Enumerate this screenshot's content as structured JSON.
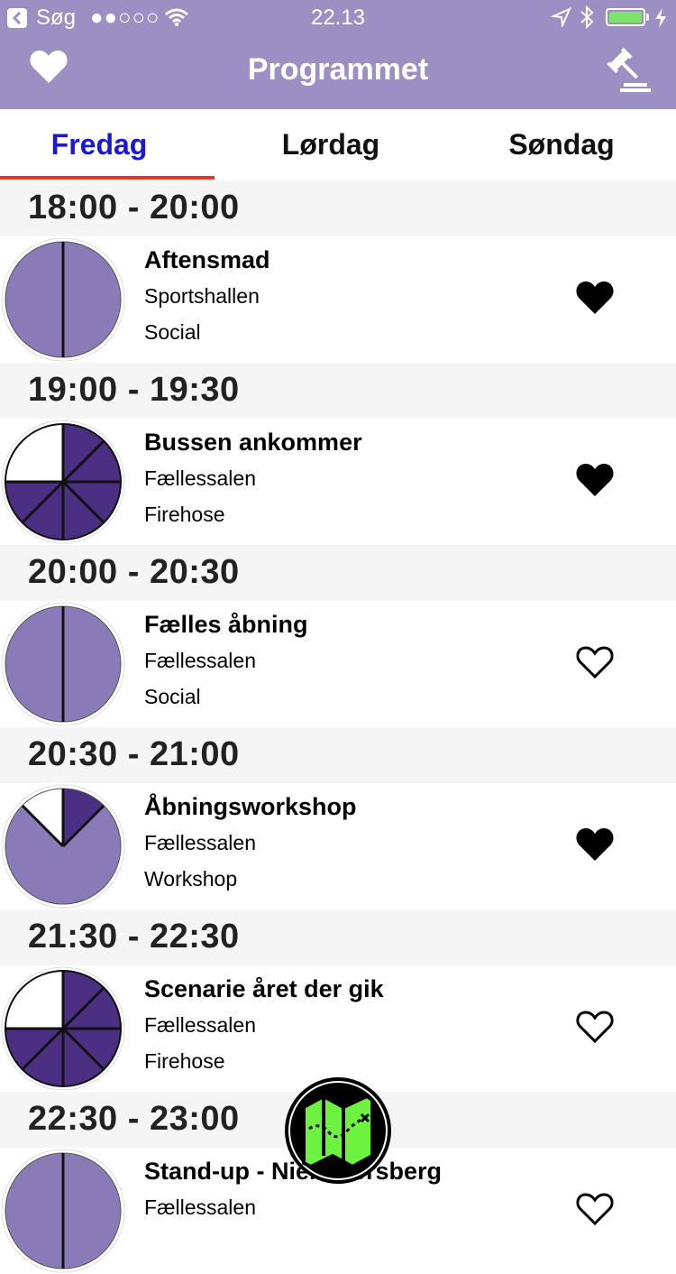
{
  "status_bar": {
    "back_label": "Søg",
    "signal": "●●○○○",
    "time": "22.13",
    "battery_level": 0.9,
    "battery_color": "#7ee36b"
  },
  "nav": {
    "title": "Programmet",
    "left_icon": "heart-icon",
    "right_icon": "gavel-icon",
    "bar_color": "#9b8fc4"
  },
  "tabs": [
    {
      "label": "Fredag",
      "active": true
    },
    {
      "label": "Lørdag",
      "active": false
    },
    {
      "label": "Søndag",
      "active": false
    }
  ],
  "schedule": [
    {
      "time": "18:00 - 20:00",
      "title": "Aftensmad",
      "location": "Sportshallen",
      "category": "Social",
      "favorite": true,
      "icon": "social-pie-icon"
    },
    {
      "time": "19:00 - 19:30",
      "title": "Bussen ankommer",
      "location": "Fællessalen",
      "category": "Firehose",
      "favorite": true,
      "icon": "firehose-pie-icon"
    },
    {
      "time": "20:00 - 20:30",
      "title": "Fælles åbning",
      "location": "Fællessalen",
      "category": "Social",
      "favorite": false,
      "icon": "social-pie-icon"
    },
    {
      "time": "20:30 - 21:00",
      "title": "Åbningsworkshop",
      "location": "Fællessalen",
      "category": "Workshop",
      "favorite": true,
      "icon": "workshop-pie-icon"
    },
    {
      "time": "21:30 - 22:30",
      "title": "Scenarie året der gik",
      "location": "Fællessalen",
      "category": "Firehose",
      "favorite": false,
      "icon": "firehose-pie-icon"
    },
    {
      "time": "22:30 - 23:00",
      "title": "Stand-up - Niels Forsberg",
      "location": "Fællessalen",
      "category": "",
      "favorite": false,
      "icon": "social-pie-icon"
    }
  ],
  "map_button": {
    "icon": "map-icon",
    "color": "#6cf23f"
  },
  "colors": {
    "active_tab": "#1818d6",
    "tab_indicator": "#e0392a",
    "light_purple": "#8a7ab8",
    "dark_purple": "#4b2f82"
  }
}
